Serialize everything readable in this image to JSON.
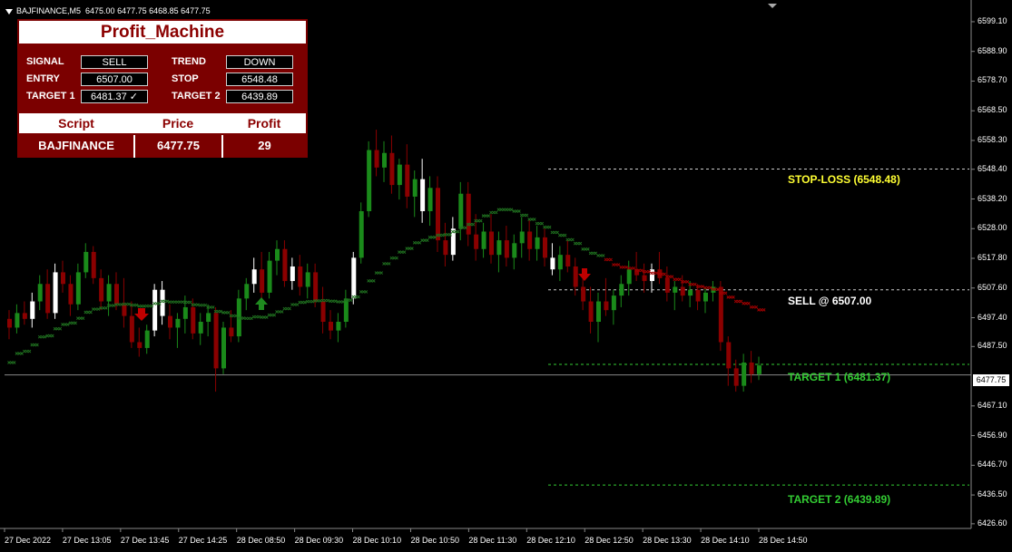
{
  "header": {
    "symbol": "BAJFINANCE,M5",
    "ohlc": "6475.00 6477.75 6468.85 6477.75"
  },
  "panel": {
    "title": "Profit_Machine",
    "signal_label": "SIGNAL",
    "signal_value": "SELL",
    "trend_label": "TREND",
    "trend_value": "DOWN",
    "entry_label": "ENTRY",
    "entry_value": "6507.00",
    "stop_label": "STOP",
    "stop_value": "6548.48",
    "target1_label": "TARGET 1",
    "target1_value": "6481.37 ✓",
    "target2_label": "TARGET 2",
    "target2_value": "6439.89",
    "col_script": "Script",
    "col_price": "Price",
    "col_profit": "Profit",
    "row_script": "BAJFINANCE",
    "row_price": "6477.75",
    "row_profit": "29"
  },
  "levels": {
    "stop_text": "STOP-LOSS (6548.48)",
    "sell_text": "SELL @ 6507.00",
    "t1_text": "TARGET 1 (6481.37)",
    "t2_text": "TARGET 2 (6439.89)"
  },
  "current_price": "6477.75",
  "y_axis_labels": [
    "6599.10",
    "6588.90",
    "6578.70",
    "6568.50",
    "6558.30",
    "6548.40",
    "6538.20",
    "6528.00",
    "6517.80",
    "6507.60",
    "6497.40",
    "6487.50",
    "6467.10",
    "6456.90",
    "6446.70",
    "6436.50",
    "6426.60"
  ],
  "x_axis_labels": [
    "27 Dec 2022",
    "27 Dec 13:05",
    "27 Dec 13:45",
    "27 Dec 14:25",
    "28 Dec 08:50",
    "28 Dec 09:30",
    "28 Dec 10:10",
    "28 Dec 10:50",
    "28 Dec 11:30",
    "28 Dec 12:10",
    "28 Dec 12:50",
    "28 Dec 13:30",
    "28 Dec 14:10",
    "28 Dec 14:50"
  ],
  "colors": {
    "bull": "#1a8a1a",
    "bear": "#8b0000",
    "stop_label": "#ffff33",
    "sell_label": "#ffffff",
    "target_label": "#33cc33"
  },
  "chart_data": {
    "type": "candlestick",
    "ylim": [
      6425,
      6605
    ],
    "stop": 6548.48,
    "entry": 6507.0,
    "target1": 6481.37,
    "target2": 6439.89,
    "current": 6477.75,
    "candles": [
      [
        6497,
        6500,
        6490,
        6494
      ],
      [
        6494,
        6502,
        6492,
        6499
      ],
      [
        6499,
        6503,
        6495,
        6497
      ],
      [
        6497,
        6506,
        6494,
        6503
      ],
      [
        6503,
        6512,
        6500,
        6509
      ],
      [
        6509,
        6514,
        6497,
        6499
      ],
      [
        6499,
        6516,
        6497,
        6513
      ],
      [
        6513,
        6517,
        6506,
        6509
      ],
      [
        6509,
        6512,
        6498,
        6502
      ],
      [
        6502,
        6516,
        6500,
        6513
      ],
      [
        6513,
        6523,
        6511,
        6520
      ],
      [
        6520,
        6522,
        6509,
        6511
      ],
      [
        6511,
        6514,
        6500,
        6503
      ],
      [
        6503,
        6512,
        6498,
        6509
      ],
      [
        6509,
        6513,
        6500,
        6502
      ],
      [
        6502,
        6511,
        6494,
        6498
      ],
      [
        6498,
        6503,
        6487,
        6489
      ],
      [
        6489,
        6494,
        6484,
        6487
      ],
      [
        6487,
        6495,
        6485,
        6493
      ],
      [
        6493,
        6509,
        6491,
        6507
      ],
      [
        6507,
        6510,
        6495,
        6498
      ],
      [
        6498,
        6502,
        6490,
        6494
      ],
      [
        6494,
        6499,
        6487,
        6497
      ],
      [
        6497,
        6505,
        6492,
        6501
      ],
      [
        6501,
        6504,
        6490,
        6492
      ],
      [
        6492,
        6499,
        6488,
        6496
      ],
      [
        6496,
        6502,
        6491,
        6499
      ],
      [
        6499,
        6501,
        6472,
        6480
      ],
      [
        6480,
        6496,
        6478,
        6494
      ],
      [
        6494,
        6500,
        6489,
        6491
      ],
      [
        6491,
        6507,
        6489,
        6504
      ],
      [
        6504,
        6511,
        6500,
        6509
      ],
      [
        6509,
        6518,
        6506,
        6514
      ],
      [
        6514,
        6520,
        6503,
        6506
      ],
      [
        6506,
        6520,
        6504,
        6517
      ],
      [
        6517,
        6524,
        6512,
        6521
      ],
      [
        6521,
        6524,
        6508,
        6510
      ],
      [
        6510,
        6518,
        6507,
        6515
      ],
      [
        6515,
        6519,
        6505,
        6508
      ],
      [
        6508,
        6516,
        6504,
        6513
      ],
      [
        6513,
        6516,
        6501,
        6503
      ],
      [
        6503,
        6508,
        6492,
        6496
      ],
      [
        6496,
        6500,
        6490,
        6493
      ],
      [
        6493,
        6499,
        6489,
        6496
      ],
      [
        6496,
        6507,
        6494,
        6504
      ],
      [
        6504,
        6520,
        6502,
        6518
      ],
      [
        6518,
        6537,
        6516,
        6534
      ],
      [
        6534,
        6558,
        6532,
        6555
      ],
      [
        6555,
        6562,
        6546,
        6549
      ],
      [
        6549,
        6558,
        6544,
        6554
      ],
      [
        6554,
        6560,
        6540,
        6543
      ],
      [
        6543,
        6552,
        6538,
        6550
      ],
      [
        6550,
        6557,
        6535,
        6539
      ],
      [
        6539,
        6548,
        6532,
        6545
      ],
      [
        6545,
        6552,
        6530,
        6534
      ],
      [
        6534,
        6546,
        6529,
        6542
      ],
      [
        6542,
        6546,
        6520,
        6524
      ],
      [
        6524,
        6530,
        6515,
        6519
      ],
      [
        6519,
        6532,
        6517,
        6528
      ],
      [
        6528,
        6544,
        6524,
        6540
      ],
      [
        6540,
        6544,
        6522,
        6526
      ],
      [
        6526,
        6533,
        6517,
        6521
      ],
      [
        6521,
        6530,
        6518,
        6527
      ],
      [
        6527,
        6533,
        6516,
        6519
      ],
      [
        6519,
        6527,
        6513,
        6524
      ],
      [
        6524,
        6529,
        6515,
        6518
      ],
      [
        6518,
        6526,
        6514,
        6523
      ],
      [
        6523,
        6532,
        6518,
        6527
      ],
      [
        6527,
        6531,
        6517,
        6521
      ],
      [
        6521,
        6529,
        6517,
        6525
      ],
      [
        6525,
        6528,
        6515,
        6518
      ],
      [
        6518,
        6523,
        6512,
        6514
      ],
      [
        6514,
        6522,
        6510,
        6519
      ],
      [
        6519,
        6524,
        6513,
        6515
      ],
      [
        6515,
        6518,
        6505,
        6508
      ],
      [
        6508,
        6513,
        6500,
        6503
      ],
      [
        6503,
        6508,
        6492,
        6496
      ],
      [
        6496,
        6506,
        6489,
        6503
      ],
      [
        6503,
        6511,
        6498,
        6500
      ],
      [
        6500,
        6507,
        6495,
        6505
      ],
      [
        6505,
        6512,
        6501,
        6509
      ],
      [
        6509,
        6517,
        6505,
        6514
      ],
      [
        6514,
        6520,
        6510,
        6512
      ],
      [
        6512,
        6516,
        6506,
        6510
      ],
      [
        6510,
        6516,
        6506,
        6514
      ],
      [
        6514,
        6520,
        6509,
        6511
      ],
      [
        6511,
        6515,
        6503,
        6506
      ],
      [
        6506,
        6510,
        6500,
        6508
      ],
      [
        6508,
        6512,
        6503,
        6505
      ],
      [
        6505,
        6510,
        6501,
        6507
      ],
      [
        6507,
        6509,
        6500,
        6503
      ],
      [
        6503,
        6508,
        6499,
        6506
      ],
      [
        6506,
        6510,
        6503,
        6508
      ],
      [
        6508,
        6510,
        6486,
        6489
      ],
      [
        6489,
        6491,
        6474,
        6480
      ],
      [
        6480,
        6483,
        6472,
        6474
      ],
      [
        6474,
        6485,
        6472,
        6482
      ],
      [
        6482,
        6486,
        6475,
        6478
      ],
      [
        6478,
        6484,
        6476,
        6481
      ]
    ]
  }
}
